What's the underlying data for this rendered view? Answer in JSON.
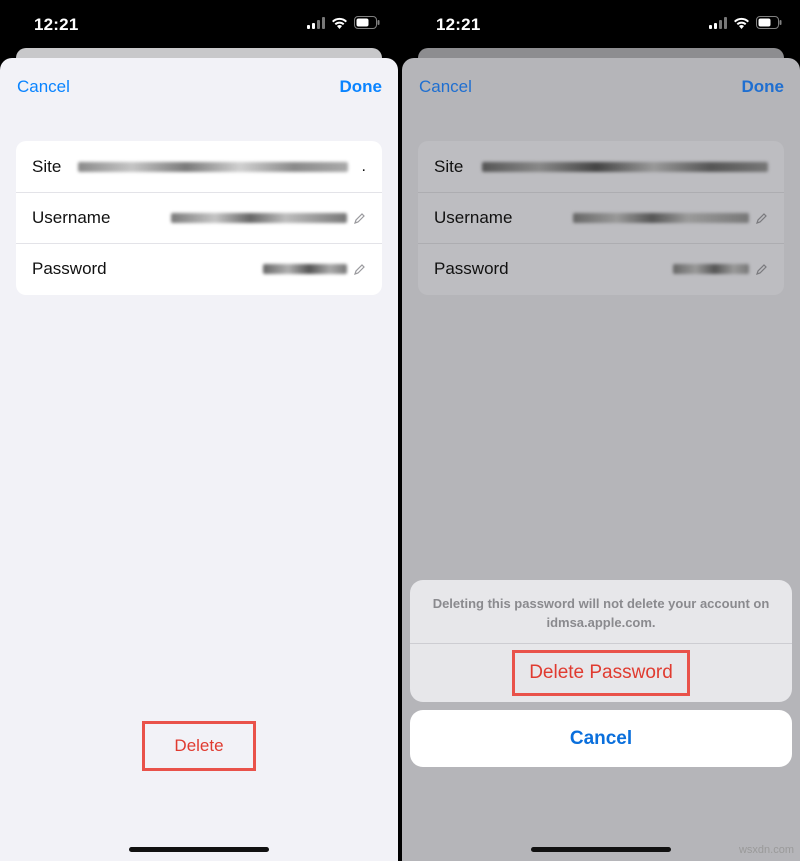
{
  "left": {
    "status": {
      "time": "12:21"
    },
    "nav": {
      "cancel": "Cancel",
      "done": "Done"
    },
    "fields": [
      {
        "label": "Site"
      },
      {
        "label": "Username"
      },
      {
        "label": "Password"
      }
    ],
    "site_trailing": ".",
    "delete_label": "Delete"
  },
  "right": {
    "status": {
      "time": "12:21"
    },
    "nav": {
      "cancel": "Cancel",
      "done": "Done"
    },
    "fields": [
      {
        "label": "Site"
      },
      {
        "label": "Username"
      },
      {
        "label": "Password"
      }
    ],
    "action_sheet": {
      "message": "Deleting this password will not delete your account on idmsa.apple.com.",
      "delete_password": "Delete Password",
      "cancel": "Cancel"
    }
  },
  "watermark": "wsxdn.com",
  "colors": {
    "accent_blue": "#0a84ff",
    "destructive_red": "#e03b30",
    "highlight_box": "#e9524a"
  },
  "icons": [
    "signal-icon",
    "wifi-icon",
    "battery-icon",
    "pencil-icon"
  ]
}
